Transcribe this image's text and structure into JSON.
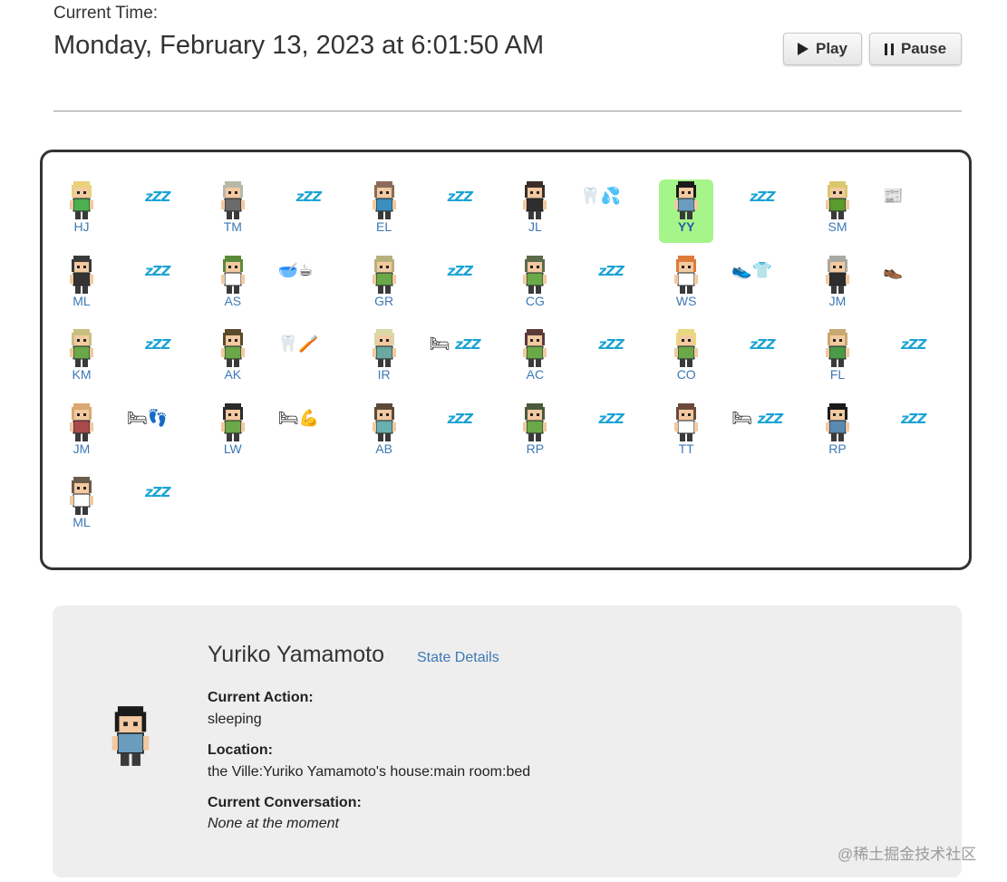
{
  "header": {
    "time_label": "Current Time:",
    "time_value": "Monday, February 13, 2023 at 6:01:50 AM",
    "play_label": "Play",
    "pause_label": "Pause"
  },
  "colors": {
    "accent": "#3c78b4",
    "selected": "#a6f58a",
    "zzz": "#1aa3d4"
  },
  "agents": [
    {
      "initials": "HJ",
      "emoji": "zzz",
      "hair": "#e8d27a",
      "shirt": "#4caf50",
      "selected": false
    },
    {
      "initials": "TM",
      "emoji": "zzz",
      "hair": "#b8b8a8",
      "shirt": "#6b6b6b",
      "selected": false
    },
    {
      "initials": "EL",
      "emoji": "zzz",
      "hair": "#8b6b5b",
      "shirt": "#3a8fc0",
      "selected": false
    },
    {
      "initials": "JL",
      "emoji": "🦷💦",
      "hair": "#3b2e28",
      "shirt": "#2d2d2d",
      "selected": false
    },
    {
      "initials": "YY",
      "emoji": "zzz",
      "hair": "#1a1a1a",
      "shirt": "#6a9dbd",
      "selected": true
    },
    {
      "initials": "SM",
      "emoji": "📰",
      "hair": "#d8c86a",
      "shirt": "#5b9a2c",
      "selected": false
    },
    {
      "initials": "ML",
      "emoji": "zzz",
      "hair": "#3a3a3a",
      "shirt": "#333333",
      "selected": false
    },
    {
      "initials": "AS",
      "emoji": "🥣☕",
      "hair": "#5b8a3a",
      "shirt": "#ffffff",
      "selected": false
    },
    {
      "initials": "GR",
      "emoji": "zzz",
      "hair": "#b8b07a",
      "shirt": "#6ba84a",
      "selected": false
    },
    {
      "initials": "CG",
      "emoji": "zzz",
      "hair": "#5b6b4a",
      "shirt": "#6ba84a",
      "selected": false
    },
    {
      "initials": "WS",
      "emoji": "👟👕",
      "hair": "#e07a3a",
      "shirt": "#ffffff",
      "selected": false
    },
    {
      "initials": "JM",
      "emoji": "👞",
      "hair": "#a8a8a0",
      "shirt": "#2d2d2d",
      "selected": false
    },
    {
      "initials": "KM",
      "emoji": "zzz",
      "hair": "#c8c080",
      "shirt": "#6ba84a",
      "selected": false
    },
    {
      "initials": "AK",
      "emoji": "🦷🪥",
      "hair": "#5b4a2a",
      "shirt": "#6ba84a",
      "selected": false
    },
    {
      "initials": "IR",
      "emoji": "🛏zzz",
      "hair": "#d8d8a8",
      "shirt": "#6ba8a0",
      "selected": false
    },
    {
      "initials": "AC",
      "emoji": "zzz",
      "hair": "#5b3a3a",
      "shirt": "#6ba84a",
      "selected": false
    },
    {
      "initials": "CO",
      "emoji": "zzz",
      "hair": "#e8d880",
      "shirt": "#6ba84a",
      "selected": false
    },
    {
      "initials": "FL",
      "emoji": "zzz",
      "hair": "#c8a870",
      "shirt": "#4a9a4a",
      "selected": false
    },
    {
      "initials": "JM",
      "emoji": "🛏👣",
      "hair": "#d8a870",
      "shirt": "#a84a4a",
      "selected": false
    },
    {
      "initials": "LW",
      "emoji": "🛏💪",
      "hair": "#2a2a2a",
      "shirt": "#6ba84a",
      "selected": false
    },
    {
      "initials": "AB",
      "emoji": "zzz",
      "hair": "#5b4a3a",
      "shirt": "#6ab0b0",
      "selected": false
    },
    {
      "initials": "RP",
      "emoji": "zzz",
      "hair": "#4a5a3a",
      "shirt": "#6ba84a",
      "selected": false
    },
    {
      "initials": "TT",
      "emoji": "🛏zzz",
      "hair": "#6b4a3a",
      "shirt": "#ffffff",
      "selected": false
    },
    {
      "initials": "RP",
      "emoji": "zzz",
      "hair": "#1a1a1a",
      "shirt": "#5a8ab0",
      "selected": false
    },
    {
      "initials": "ML",
      "emoji": "zzz",
      "hair": "#6b5b4a",
      "shirt": "#ffffff",
      "selected": false
    }
  ],
  "zzz_text": "zZZ",
  "details": {
    "name": "Yuriko Yamamoto",
    "state_link": "State Details",
    "action_label": "Current Action:",
    "action_value": "sleeping",
    "location_label": "Location:",
    "location_value": "the Ville:Yuriko Yamamoto's house:main room:bed",
    "conversation_label": "Current Conversation:",
    "conversation_value": "None at the moment"
  },
  "watermark": "@稀土掘金技术社区"
}
